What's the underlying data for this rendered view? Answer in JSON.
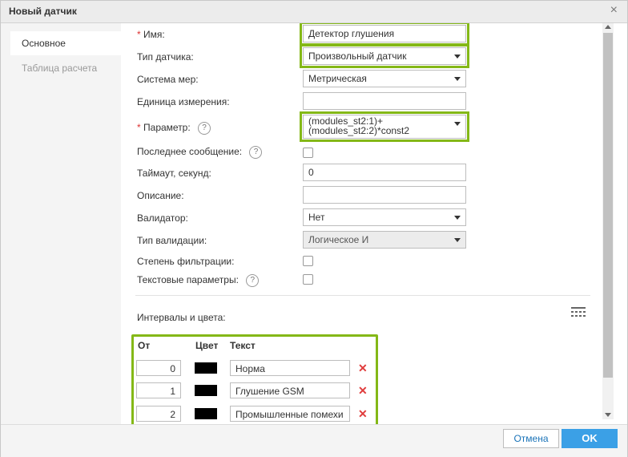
{
  "dialog": {
    "title": "Новый датчик",
    "close_glyph": "×"
  },
  "sidebar": {
    "tabs": [
      {
        "label": "Основное",
        "active": true
      },
      {
        "label": "Таблица расчета",
        "active": false
      }
    ]
  },
  "form": {
    "name": {
      "label": "Имя:",
      "required": "*",
      "value": "Детектор глушения"
    },
    "sensor_type": {
      "label": "Тип датчика:",
      "value": "Произвольный датчик"
    },
    "unit_system": {
      "label": "Система мер:",
      "value": "Метрическая"
    },
    "unit": {
      "label": "Единица измерения:",
      "value": ""
    },
    "parameter": {
      "label": "Параметр:",
      "required": "*",
      "line1": "(modules_st2:1)+",
      "line2": "(modules_st2:2)*const2"
    },
    "last_message": {
      "label": "Последнее сообщение:",
      "checked": false
    },
    "timeout": {
      "label": "Таймаут, секунд:",
      "value": "0"
    },
    "description": {
      "label": "Описание:",
      "value": ""
    },
    "validator": {
      "label": "Валидатор:",
      "value": "Нет"
    },
    "validation_type": {
      "label": "Тип валидации:",
      "value": "Логическое И"
    },
    "filtration": {
      "label": "Степень фильтрации:",
      "checked": false
    },
    "text_params": {
      "label": "Текстовые параметры:",
      "checked": false
    },
    "help_glyph": "?"
  },
  "intervals": {
    "title": "Интервалы и цвета:",
    "headers": {
      "from": "От",
      "color": "Цвет",
      "text": "Текст"
    },
    "rows": [
      {
        "from": "0",
        "color": "#000000",
        "text": "Норма"
      },
      {
        "from": "1",
        "color": "#000000",
        "text": "Глушение GSM"
      },
      {
        "from": "2",
        "color": "#000000",
        "text": "Промышленные помехи"
      }
    ],
    "delete_glyph": "✕"
  },
  "footer": {
    "cancel_label": "Отмена",
    "ok_label": "OK"
  },
  "colors": {
    "highlight": "#84b817",
    "ok_button": "#3ba0e6",
    "delete": "#e03c3c"
  }
}
